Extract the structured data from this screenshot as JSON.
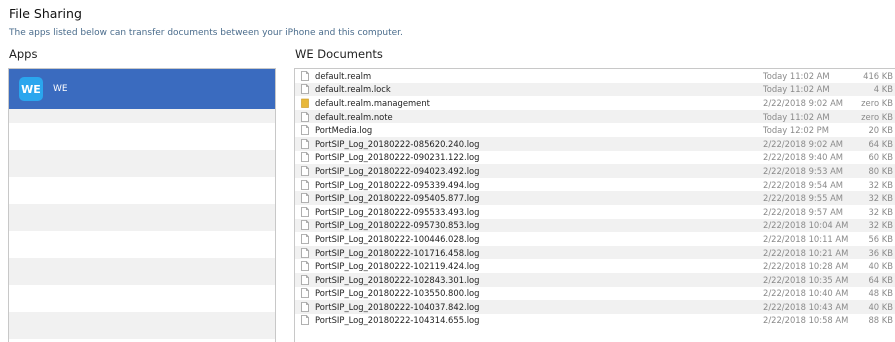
{
  "header": {
    "title": "File Sharing",
    "subtitle": "The apps listed below can transfer documents between your iPhone and this computer."
  },
  "apps": {
    "header": "Apps",
    "items": [
      {
        "name": "WE",
        "icon": "we-app-icon",
        "icon_text": "WE",
        "selected": true
      }
    ]
  },
  "documents": {
    "header": "WE Documents",
    "files": [
      {
        "name": "default.realm",
        "date": "Today 11:02 AM",
        "size": "416 KB",
        "icon": "file-icon"
      },
      {
        "name": "default.realm.lock",
        "date": "Today 11:02 AM",
        "size": "4 KB",
        "icon": "file-icon"
      },
      {
        "name": "default.realm.management",
        "date": "2/22/2018 9:02 AM",
        "size": "zero KB",
        "icon": "folder-icon"
      },
      {
        "name": "default.realm.note",
        "date": "Today 11:02 AM",
        "size": "zero KB",
        "icon": "file-icon"
      },
      {
        "name": "PortMedia.log",
        "date": "Today 12:02 PM",
        "size": "20 KB",
        "icon": "file-icon"
      },
      {
        "name": "PortSIP_Log_20180222-085620.240.log",
        "date": "2/22/2018 9:02 AM",
        "size": "64 KB",
        "icon": "file-icon"
      },
      {
        "name": "PortSIP_Log_20180222-090231.122.log",
        "date": "2/22/2018 9:40 AM",
        "size": "60 KB",
        "icon": "file-icon"
      },
      {
        "name": "PortSIP_Log_20180222-094023.492.log",
        "date": "2/22/2018 9:53 AM",
        "size": "80 KB",
        "icon": "file-icon"
      },
      {
        "name": "PortSIP_Log_20180222-095339.494.log",
        "date": "2/22/2018 9:54 AM",
        "size": "32 KB",
        "icon": "file-icon"
      },
      {
        "name": "PortSIP_Log_20180222-095405.877.log",
        "date": "2/22/2018 9:55 AM",
        "size": "32 KB",
        "icon": "file-icon"
      },
      {
        "name": "PortSIP_Log_20180222-095533.493.log",
        "date": "2/22/2018 9:57 AM",
        "size": "32 KB",
        "icon": "file-icon"
      },
      {
        "name": "PortSIP_Log_20180222-095730.853.log",
        "date": "2/22/2018 10:04 AM",
        "size": "32 KB",
        "icon": "file-icon"
      },
      {
        "name": "PortSIP_Log_20180222-100446.028.log",
        "date": "2/22/2018 10:11 AM",
        "size": "56 KB",
        "icon": "file-icon"
      },
      {
        "name": "PortSIP_Log_20180222-101716.458.log",
        "date": "2/22/2018 10:21 AM",
        "size": "36 KB",
        "icon": "file-icon"
      },
      {
        "name": "PortSIP_Log_20180222-102119.424.log",
        "date": "2/22/2018 10:28 AM",
        "size": "40 KB",
        "icon": "file-icon"
      },
      {
        "name": "PortSIP_Log_20180222-102843.301.log",
        "date": "2/22/2018 10:35 AM",
        "size": "64 KB",
        "icon": "file-icon"
      },
      {
        "name": "PortSIP_Log_20180222-103550.800.log",
        "date": "2/22/2018 10:40 AM",
        "size": "48 KB",
        "icon": "file-icon"
      },
      {
        "name": "PortSIP_Log_20180222-104037.842.log",
        "date": "2/22/2018 10:43 AM",
        "size": "40 KB",
        "icon": "file-icon"
      },
      {
        "name": "PortSIP_Log_20180222-104314.655.log",
        "date": "2/22/2018 10:58 AM",
        "size": "88 KB",
        "icon": "file-icon"
      }
    ]
  },
  "colors": {
    "selection": "#3a6bbf",
    "app_icon_bg": "#2aa6ee",
    "folder": "#e8b83a",
    "subtitle": "#4a6c8c"
  }
}
